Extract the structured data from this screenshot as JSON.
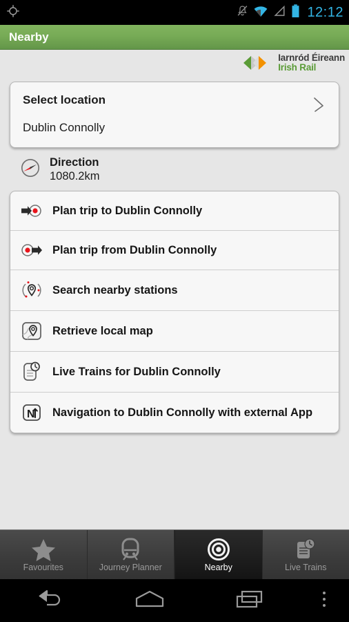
{
  "statusbar": {
    "gps_icon": "gps-crosshair-icon",
    "mute_icon": "bell-muted-icon",
    "wifi_icon": "wifi-icon",
    "signal_icon": "signal-triangle-icon",
    "battery_icon": "battery-icon",
    "time": "12:12",
    "time_color": "#33b5e5"
  },
  "actionbar": {
    "title": "Nearby",
    "bg_color": "#77ab56"
  },
  "brand": {
    "line1": "Iarnród Éireann",
    "line2": "Irish Rail",
    "green": "#5a9b36",
    "orange": "#f39100",
    "dark": "#3b3b3b"
  },
  "location_card": {
    "title": "Select location",
    "value": "Dublin Connolly",
    "chevron_icon": "chevron-right-icon"
  },
  "direction": {
    "icon": "compass-icon",
    "label": "Direction",
    "value": "1080.2km"
  },
  "actions": [
    {
      "icon": "plan-trip-to-icon",
      "label": "Plan trip to Dublin Connolly"
    },
    {
      "icon": "plan-trip-from-icon",
      "label": "Plan trip from Dublin Connolly"
    },
    {
      "icon": "search-nearby-icon",
      "label": "Search nearby stations"
    },
    {
      "icon": "map-pin-icon",
      "label": "Retrieve local map"
    },
    {
      "icon": "live-trains-icon",
      "label": "Live Trains for Dublin Connolly"
    },
    {
      "icon": "navigation-n-icon",
      "label": "Navigation to Dublin Connolly with external App"
    }
  ],
  "tabs": [
    {
      "icon": "star-icon",
      "label": "Favourites",
      "active": false
    },
    {
      "icon": "train-icon",
      "label": "Journey Planner",
      "active": false
    },
    {
      "icon": "target-icon",
      "label": "Nearby",
      "active": true
    },
    {
      "icon": "live-trains-icon",
      "label": "Live Trains",
      "active": false
    }
  ],
  "navbar": [
    {
      "icon": "back-icon"
    },
    {
      "icon": "home-icon"
    },
    {
      "icon": "recents-icon"
    },
    {
      "icon": "overflow-menu-icon"
    }
  ]
}
